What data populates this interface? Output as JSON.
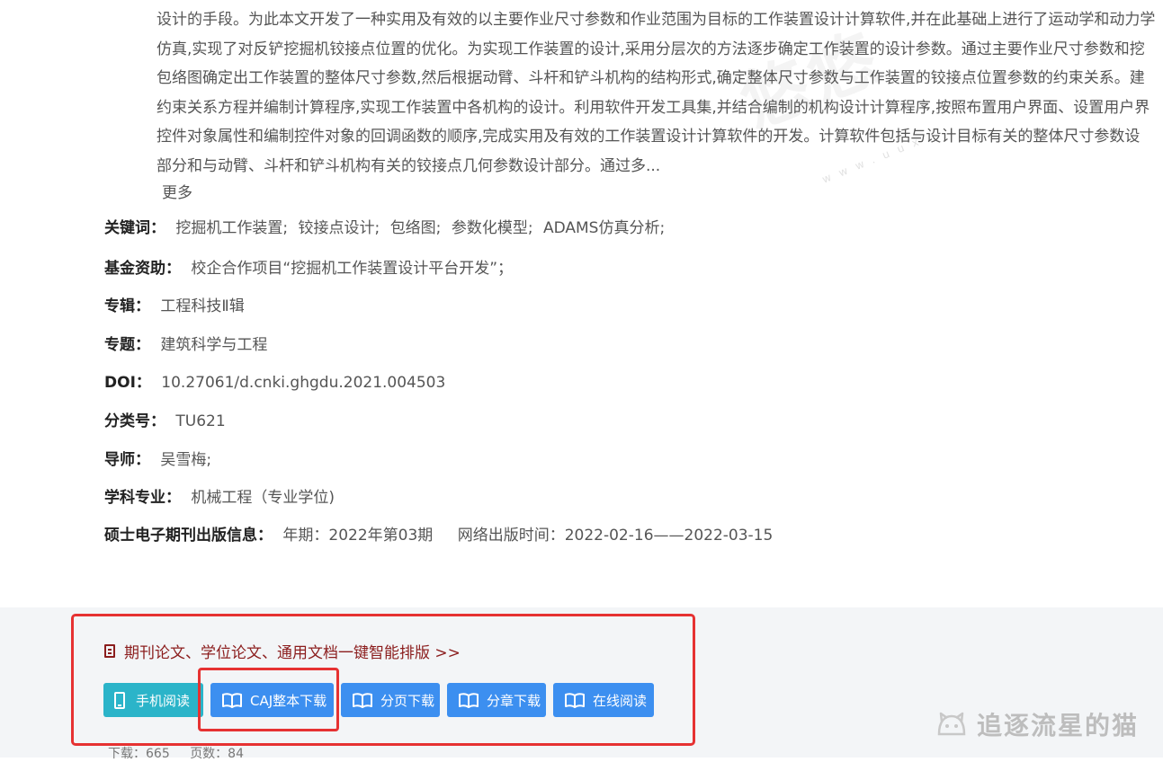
{
  "abstract": {
    "lines": [
      "设计的手段。为此本文开发了一种实用及有效的以主要作业尺寸参数和作业范围为目标的工作装置设计计算软件,并在此基础上进行了运动学和动力学",
      "仿真,实现了对反铲挖掘机铰接点位置的优化。为实现工作装置的设计,采用分层次的方法逐步确定工作装置的设计参数。通过主要作业尺寸参数和挖",
      "包络图确定出工作装置的整体尺寸参数,然后根据动臂、斗杆和铲斗机构的结构形式,确定整体尺寸参数与工作装置的铰接点位置参数的约束关系。建",
      "约束关系方程并编制计算程序,实现工作装置中各机构的设计。利用软件开发工具集,并结合编制的机构设计计算程序,按照布置用户界面、设置用户界",
      "控件对象属性和编制控件对象的回调函数的顺序,完成实用及有效的工作装置设计计算软件的开发。计算软件包括与设计目标有关的整体尺寸参数设",
      "部分和与动臂、斗杆和铲斗机构有关的铰接点几何参数设计部分。通过多..."
    ],
    "more": "更多"
  },
  "watermark": {
    "text": "悠悠",
    "url": "www.uux"
  },
  "meta": {
    "keywords": {
      "label": "关键词：",
      "values": [
        "挖掘机工作装置;",
        "铰接点设计;",
        "包络图;",
        "参数化模型;",
        "ADAMS仿真分析;"
      ]
    },
    "fund": {
      "label": "基金资助：",
      "value": "校企合作项目“挖掘机工作装置设计平台开发”；"
    },
    "album": {
      "label": "专辑：",
      "value": "工程科技Ⅱ辑"
    },
    "topic": {
      "label": "专题：",
      "value": "建筑科学与工程"
    },
    "doi": {
      "label": "DOI：",
      "value": "10.27061/d.cnki.ghgdu.2021.004503"
    },
    "classno": {
      "label": "分类号：",
      "value": "TU621"
    },
    "advisor": {
      "label": "导师：",
      "value": "吴雪梅;"
    },
    "major": {
      "label": "学科专业：",
      "value": "机械工程（专业学位)"
    },
    "pubinfo": {
      "label": "硕士电子期刊出版信息：",
      "issue": "年期：2022年第03期",
      "online": "网络出版时间：2022-02-16——2022-03-15"
    }
  },
  "download": {
    "promo": "期刊论文、学位论文、通用文档一键智能排版 >>",
    "buttons": {
      "mobile": "手机阅读",
      "caj": "CAJ整本下载",
      "page": "分页下载",
      "chapter": "分章下载",
      "online": "在线阅读"
    },
    "stats": {
      "downloads": "下载：665",
      "pages": "页数：84"
    }
  },
  "brand": "追逐流星的猫",
  "colors": {
    "primary_button": "#3c8ff0",
    "mobile_button": "#2bb4c9",
    "highlight": "#e63232",
    "promo_text": "#8b1d1d"
  }
}
